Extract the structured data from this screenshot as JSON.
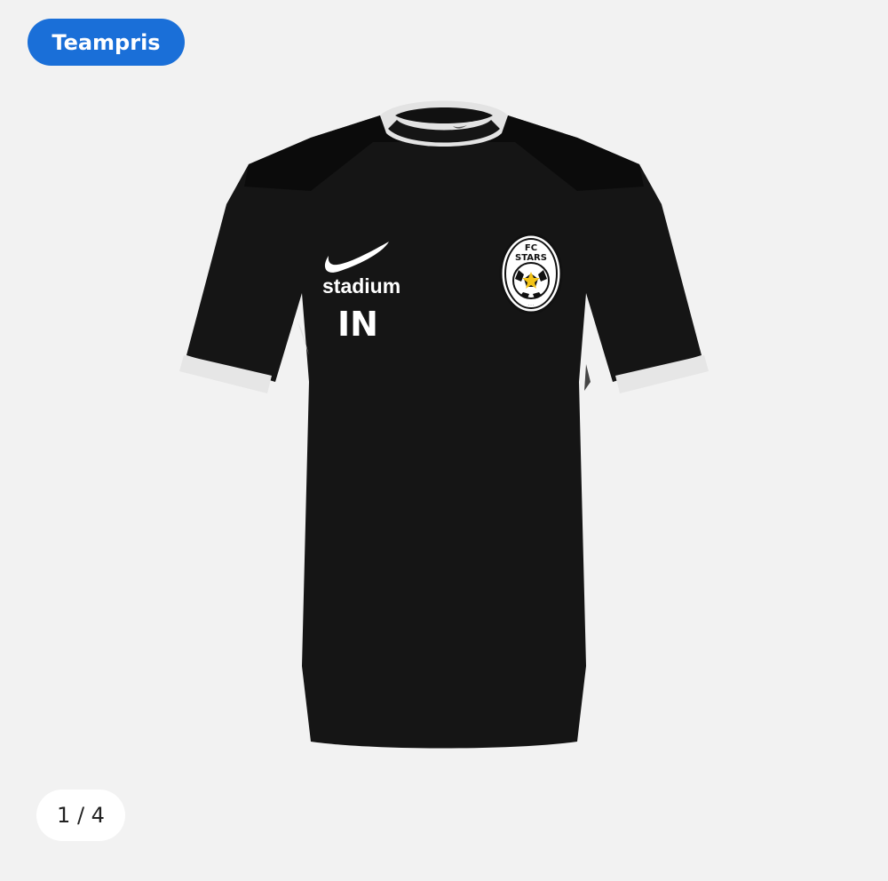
{
  "badge": {
    "label": "Teampris"
  },
  "product": {
    "sponsor_text": "stadium",
    "initials": "IN",
    "crest": {
      "line1": "FC",
      "line2": "STARS"
    },
    "colors": {
      "shirt": "#151515",
      "trim": "#e8e8e8"
    }
  },
  "gallery": {
    "counter": "1 / 4"
  }
}
